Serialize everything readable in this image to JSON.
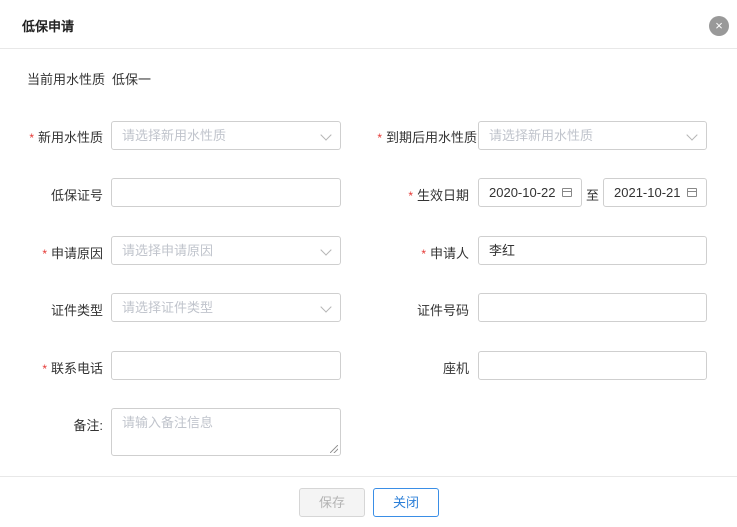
{
  "dialog": {
    "title": "低保申请",
    "close_icon": "×"
  },
  "current": {
    "label": "当前用水性质",
    "value": "低保一"
  },
  "form": {
    "required_mark": "*",
    "new_nature": {
      "label": "新用水性质",
      "placeholder": "请选择新用水性质"
    },
    "expire_nature": {
      "label": "到期后用水性质",
      "placeholder": "请选择新用水性质"
    },
    "cert_no": {
      "label": "低保证号",
      "value": ""
    },
    "effective_date": {
      "label": "生效日期",
      "start": "2020-10-22",
      "to": "至",
      "end": "2021-10-21"
    },
    "reason": {
      "label": "申请原因",
      "placeholder": "请选择申请原因"
    },
    "applicant": {
      "label": "申请人",
      "value": "李红"
    },
    "id_type": {
      "label": "证件类型",
      "placeholder": "请选择证件类型"
    },
    "id_no": {
      "label": "证件号码",
      "value": ""
    },
    "phone": {
      "label": "联系电话",
      "value": ""
    },
    "landline": {
      "label": "座机",
      "value": ""
    },
    "remark": {
      "label": "备注:",
      "placeholder": "请输入备注信息"
    }
  },
  "footer": {
    "save_label": "保存",
    "close_label": "关闭"
  },
  "colors": {
    "required": "#e53935",
    "primary": "#2b7fd8",
    "placeholder": "#c0c4cc",
    "disabled_bg": "#f4f4f4"
  }
}
